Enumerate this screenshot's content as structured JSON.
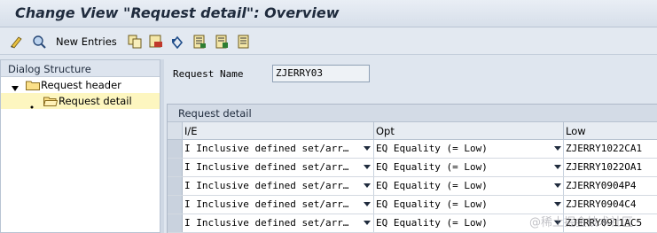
{
  "title": "Change View \"Request detail\": Overview",
  "toolbar": {
    "new_entries_label": "New Entries",
    "icons": [
      "edit-toggle-icon",
      "display-icon",
      "copy-icon",
      "delete-icon",
      "undo-icon",
      "select-all-icon",
      "select-block-icon",
      "deselect-all-icon"
    ]
  },
  "dialog_structure": {
    "heading": "Dialog Structure",
    "items": [
      {
        "label": "Request header",
        "selected": false
      },
      {
        "label": "Request detail",
        "selected": true
      }
    ]
  },
  "request": {
    "name_label": "Request Name",
    "name_value": "ZJERRY03"
  },
  "table": {
    "title": "Request detail",
    "columns": [
      "I/E",
      "Opt",
      "Low"
    ],
    "rows": [
      [
        "I Inclusive defined set/arr…",
        "EQ Equality (= Low)",
        "ZJERRY1022CA1"
      ],
      [
        "I Inclusive defined set/arr…",
        "EQ Equality (= Low)",
        "ZJERRY1022OA1"
      ],
      [
        "I Inclusive defined set/arr…",
        "EQ Equality (= Low)",
        "ZJERRY0904P4"
      ],
      [
        "I Inclusive defined set/arr…",
        "EQ Equality (= Low)",
        "ZJERRY0904C4"
      ],
      [
        "I Inclusive defined set/arr…",
        "EQ Equality (= Low)",
        "ZJERRY0911AC5"
      ]
    ]
  },
  "watermark": "@稀土掘金技术社区"
}
